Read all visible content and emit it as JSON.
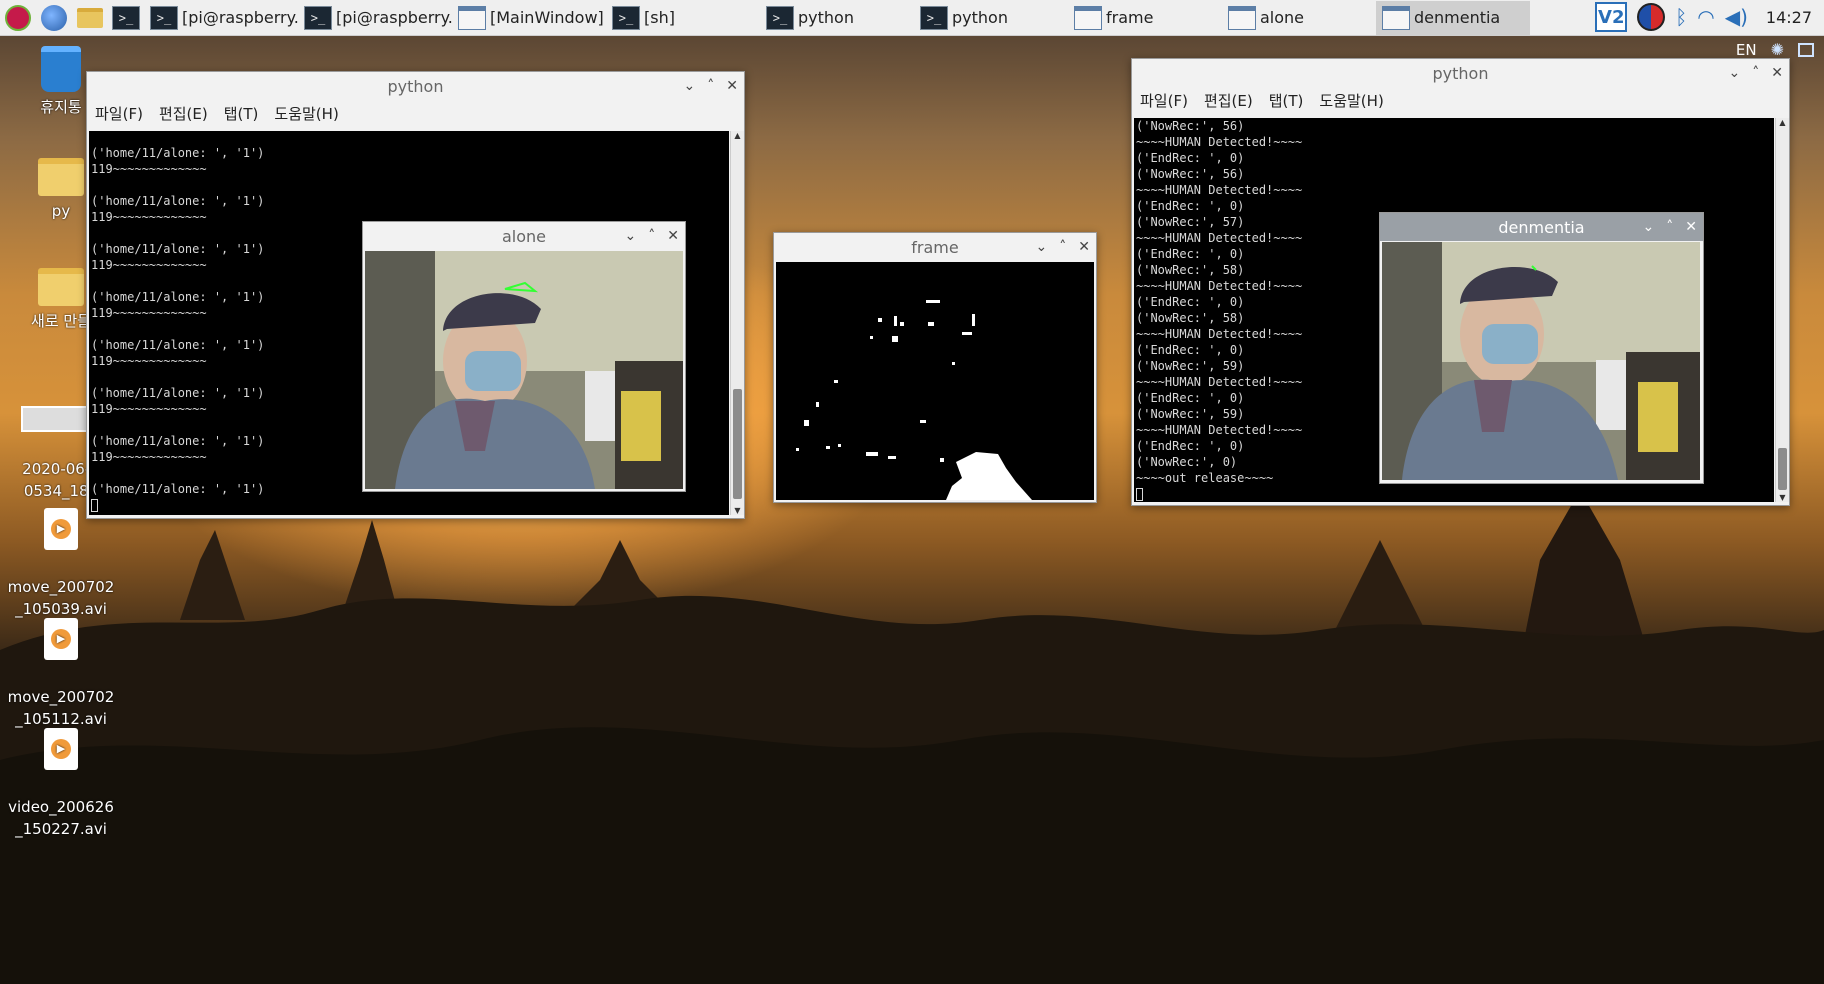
{
  "taskbar": {
    "tasks": [
      {
        "label": "[pi@raspberry...",
        "type": "terminal",
        "active": false
      },
      {
        "label": "[pi@raspberry...",
        "type": "terminal",
        "active": false
      },
      {
        "label": "[MainWindow]",
        "type": "window",
        "active": false
      },
      {
        "label": "[sh]",
        "type": "terminal",
        "active": false
      },
      {
        "label": "python",
        "type": "terminal",
        "active": false
      },
      {
        "label": "python",
        "type": "terminal",
        "active": false
      },
      {
        "label": "frame",
        "type": "window",
        "active": false
      },
      {
        "label": "alone",
        "type": "window",
        "active": false
      },
      {
        "label": "denmentia",
        "type": "window",
        "active": true
      }
    ],
    "clock": "14:27",
    "lang": "EN",
    "tray_icons": [
      "vnc-icon",
      "korean-ime-icon",
      "bluetooth-icon",
      "wifi-icon",
      "volume-icon"
    ]
  },
  "desktop_icons": [
    {
      "name": "trash",
      "label": "휴지통",
      "kind": "trash"
    },
    {
      "name": "folder-py",
      "label": "py",
      "kind": "folder"
    },
    {
      "name": "folder-new",
      "label": "새로 만들",
      "kind": "folder"
    },
    {
      "name": "image-file",
      "label": "2020-06-2\n0534_182",
      "kind": "image"
    },
    {
      "name": "video-move-105039",
      "label": "move_200702\n_105039.avi",
      "kind": "video"
    },
    {
      "name": "video-move-105112",
      "label": "move_200702\n_105112.avi",
      "kind": "video"
    },
    {
      "name": "video-200626",
      "label": "video_200626\n_150227.avi",
      "kind": "video"
    }
  ],
  "window_python_left": {
    "title": "python",
    "menu": [
      "파일(F)",
      "편집(E)",
      "탭(T)",
      "도움말(H)"
    ],
    "lines": [
      "('home/11/alone: ', '1')",
      "119~~~~~~~~~~~~~",
      "",
      "('home/11/alone: ', '1')",
      "119~~~~~~~~~~~~~",
      "",
      "('home/11/alone: ', '1')",
      "119~~~~~~~~~~~~~",
      "",
      "('home/11/alone: ', '1')",
      "119~~~~~~~~~~~~~",
      "",
      "('home/11/alone: ', '1')",
      "119~~~~~~~~~~~~~",
      "",
      "('home/11/alone: ', '1')",
      "119~~~~~~~~~~~~~",
      "",
      "('home/11/alone: ', '1')",
      "119~~~~~~~~~~~~~",
      "",
      "('home/11/alone: ', '1')"
    ]
  },
  "window_alone": {
    "title": "alone"
  },
  "window_frame": {
    "title": "frame"
  },
  "window_python_right": {
    "title": "python",
    "menu": [
      "파일(F)",
      "편집(E)",
      "탭(T)",
      "도움말(H)"
    ],
    "lines": [
      "('NowRec:', 56)",
      "~~~~HUMAN Detected!~~~~",
      "('EndRec: ', 0)",
      "('NowRec:', 56)",
      "~~~~HUMAN Detected!~~~~",
      "('EndRec: ', 0)",
      "('NowRec:', 57)",
      "~~~~HUMAN Detected!~~~~",
      "('EndRec: ', 0)",
      "('NowRec:', 58)",
      "~~~~HUMAN Detected!~~~~",
      "('EndRec: ', 0)",
      "('NowRec:', 58)",
      "~~~~HUMAN Detected!~~~~",
      "('EndRec: ', 0)",
      "('NowRec:', 59)",
      "~~~~HUMAN Detected!~~~~",
      "('EndRec: ', 0)",
      "('NowRec:', 59)",
      "~~~~HUMAN Detected!~~~~",
      "('EndRec: ', 0)",
      "('NowRec:', 0)",
      "~~~~out release~~~~"
    ]
  },
  "window_denmentia": {
    "title": "denmentia"
  },
  "window_buttons": {
    "minimize": "⌄",
    "maximize": "˄",
    "close": "✕"
  }
}
